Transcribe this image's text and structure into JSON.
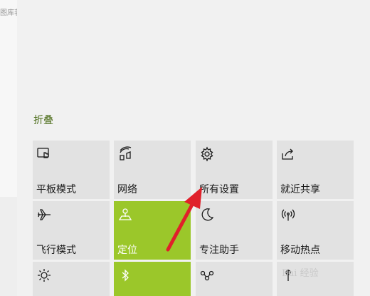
{
  "background_window": {
    "fragment_text": "图库著"
  },
  "action_center": {
    "collapse_label": "折叠",
    "accent_color": "#9bc72a",
    "tiles": [
      {
        "label": "平板模式",
        "icon": "tablet-mode-icon",
        "active": false
      },
      {
        "label": "网络",
        "icon": "network-icon",
        "active": false
      },
      {
        "label": "所有设置",
        "icon": "settings-gear-icon",
        "active": false
      },
      {
        "label": "就近共享",
        "icon": "nearby-share-icon",
        "active": false
      },
      {
        "label": "飞行模式",
        "icon": "airplane-icon",
        "active": false
      },
      {
        "label": "定位",
        "icon": "location-icon",
        "active": true
      },
      {
        "label": "专注助手",
        "icon": "moon-icon",
        "active": false
      },
      {
        "label": "移动热点",
        "icon": "hotspot-icon",
        "active": false
      },
      {
        "label": "",
        "icon": "brightness-icon",
        "active": false
      },
      {
        "label": "",
        "icon": "bluetooth-icon",
        "active": true
      },
      {
        "label": "",
        "icon": "connect-icon",
        "active": false
      },
      {
        "label": "",
        "icon": "pen-icon",
        "active": false
      }
    ]
  },
  "annotation": {
    "arrow_color": "#e0202a"
  },
  "watermark": {
    "text": "Bai 经验"
  }
}
